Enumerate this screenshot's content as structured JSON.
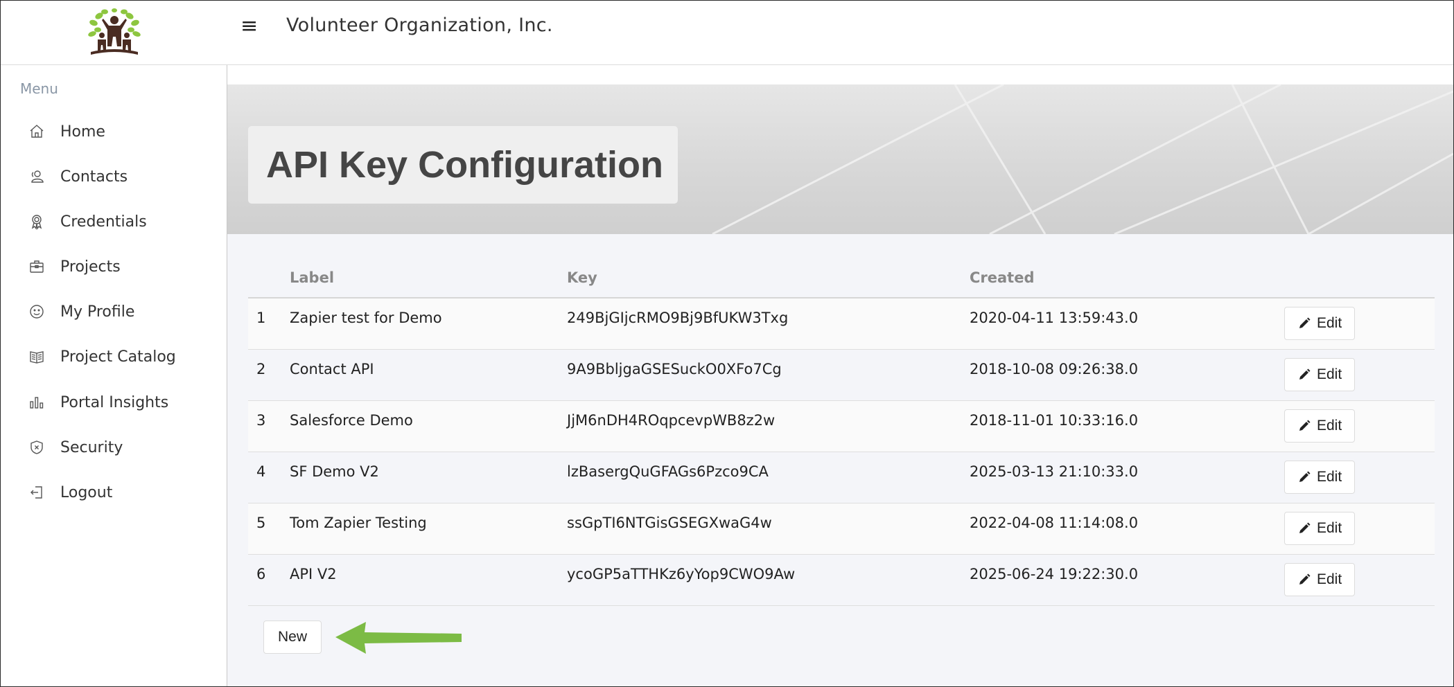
{
  "header": {
    "logo_icon": "tree-people-logo",
    "menu_icon": "hamburger-icon",
    "hamburger_glyph": "≡",
    "org_name": "Volunteer Organization, Inc."
  },
  "sidebar": {
    "menu_title": "Menu",
    "items": [
      {
        "label": "Home",
        "icon": "home-icon"
      },
      {
        "label": "Contacts",
        "icon": "contacts-icon"
      },
      {
        "label": "Credentials",
        "icon": "credentials-icon"
      },
      {
        "label": "Projects",
        "icon": "projects-icon"
      },
      {
        "label": "My Profile",
        "icon": "profile-icon"
      },
      {
        "label": "Project Catalog",
        "icon": "catalog-icon"
      },
      {
        "label": "Portal Insights",
        "icon": "insights-icon"
      },
      {
        "label": "Security",
        "icon": "security-icon"
      },
      {
        "label": "Logout",
        "icon": "logout-icon"
      }
    ]
  },
  "main": {
    "page_title": "API Key Configuration",
    "table": {
      "columns": [
        "",
        "Label",
        "Key",
        "Created",
        ""
      ],
      "rows": [
        {
          "num": "1",
          "label": "Zapier test for Demo",
          "key": "249BjGIjcRMO9Bj9BfUKW3Txg",
          "created": "2020-04-11 13:59:43.0",
          "action": "Edit"
        },
        {
          "num": "2",
          "label": "Contact API",
          "key": "9A9BbljgaGSESuckO0XFo7Cg",
          "created": "2018-10-08 09:26:38.0",
          "action": "Edit"
        },
        {
          "num": "3",
          "label": "Salesforce Demo",
          "key": "JjM6nDH4ROqpcevpWB8z2w",
          "created": "2018-11-01 10:33:16.0",
          "action": "Edit"
        },
        {
          "num": "4",
          "label": "SF Demo V2",
          "key": "lzBasergQuGFAGs6Pzco9CA",
          "created": "2025-03-13 21:10:33.0",
          "action": "Edit"
        },
        {
          "num": "5",
          "label": "Tom Zapier Testing",
          "key": "ssGpTI6NTGisGSEGXwaG4w",
          "created": "2022-04-08 11:14:08.0",
          "action": "Edit"
        },
        {
          "num": "6",
          "label": "API V2",
          "key": "ycoGP5aTTHKz6yYop9CWO9Aw",
          "created": "2025-06-24 19:22:30.0",
          "action": "Edit"
        }
      ]
    },
    "new_button_label": "New",
    "annotation_arrow_color": "#7cbb45"
  }
}
